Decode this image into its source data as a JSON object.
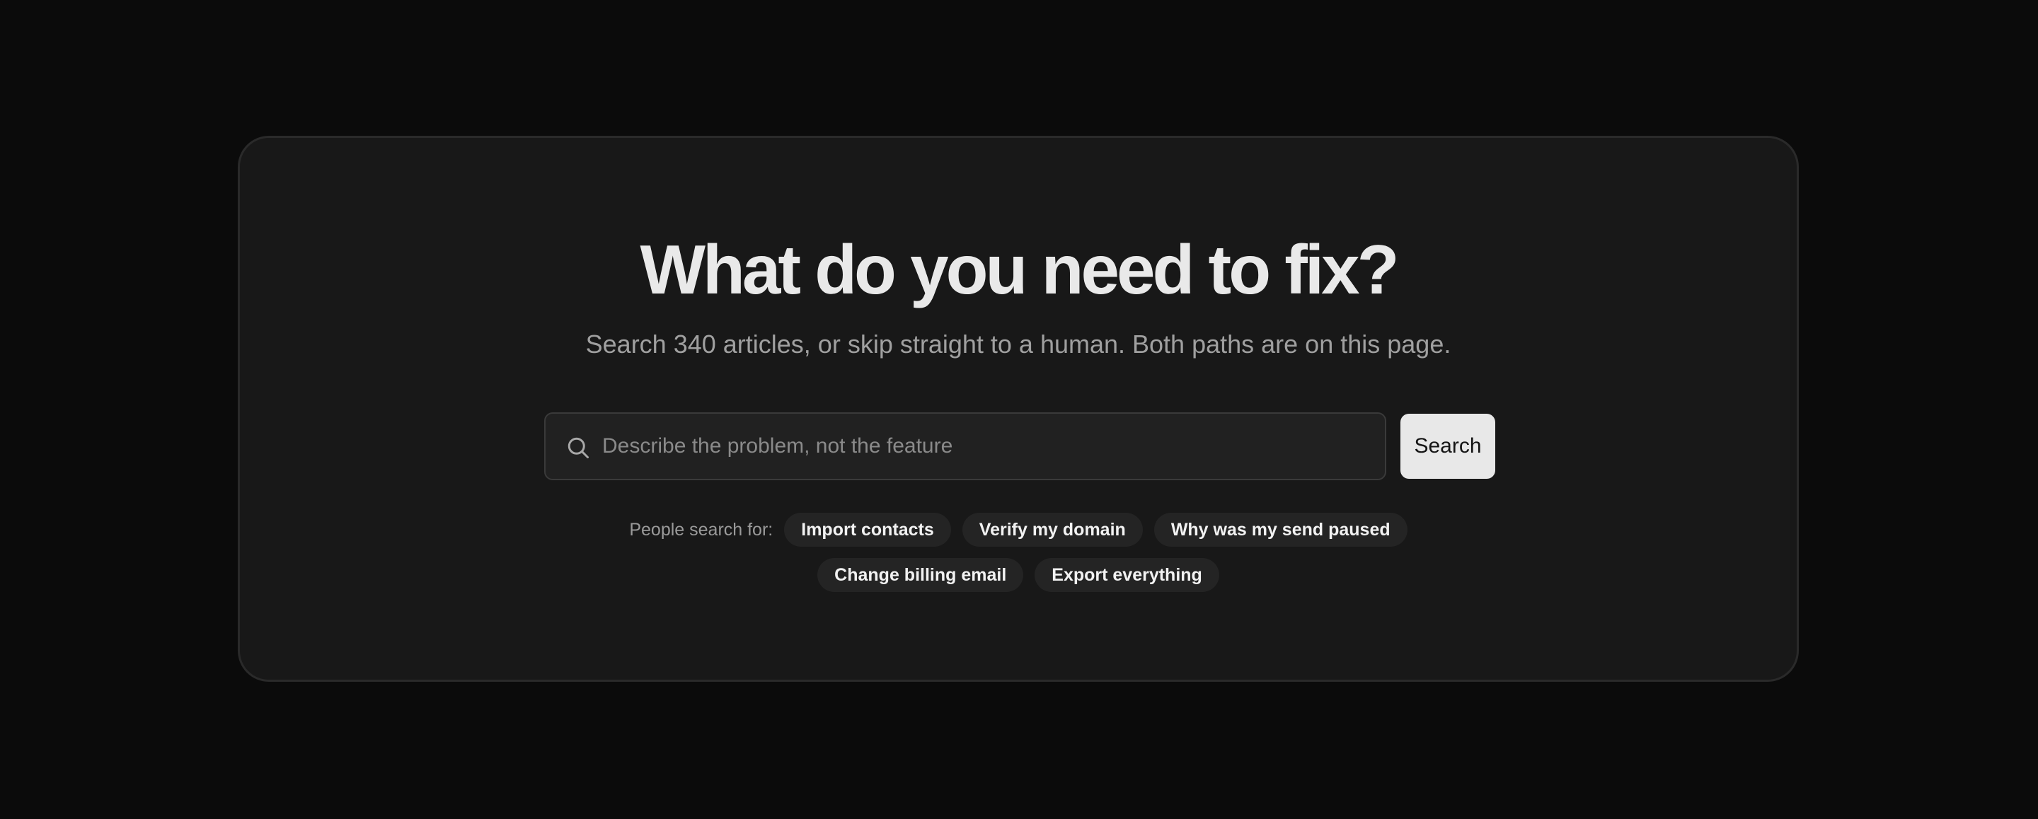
{
  "hero": {
    "title": "What do you need to fix?",
    "subtitle": "Search 340 articles, or skip straight to a human. Both paths are on this page."
  },
  "search": {
    "icon": "search-icon",
    "placeholder": "Describe the problem, not the feature",
    "value": "",
    "button_label": "Search"
  },
  "suggestions": {
    "label": "People search for:",
    "items": [
      "Import contacts",
      "Verify my domain",
      "Why was my send paused",
      "Change billing email",
      "Export everything"
    ]
  },
  "colors": {
    "page_background": "#0b0b0b",
    "card_background": "#181818",
    "button_background": "#e8e8e8",
    "chip_background": "#242424"
  }
}
